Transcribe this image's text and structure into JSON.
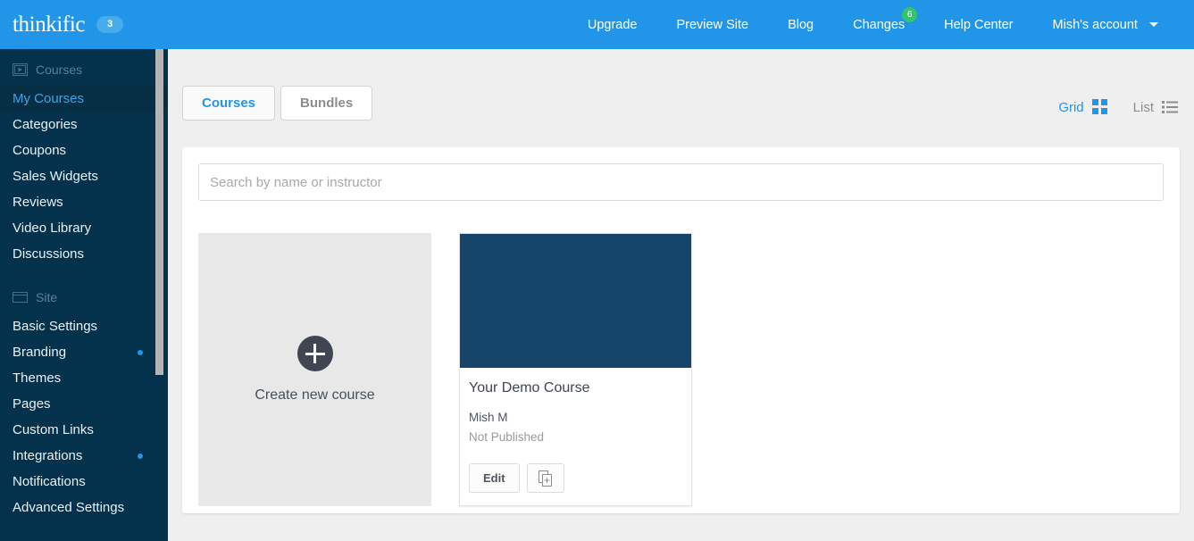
{
  "topbar": {
    "brand": "thinkific",
    "brand_badge": "3",
    "nav": [
      {
        "label": "Upgrade",
        "badge": null,
        "icon": null
      },
      {
        "label": "Preview Site",
        "badge": null,
        "icon": null
      },
      {
        "label": "Blog",
        "badge": null,
        "icon": null
      },
      {
        "label": "Changes",
        "badge": "6",
        "icon": null
      },
      {
        "label": "Help Center",
        "badge": null,
        "icon": null
      },
      {
        "label": "Mish's account",
        "badge": null,
        "icon": "chevron-down-icon"
      }
    ],
    "colors": {
      "background": "#2196e8",
      "badge": "#46aceb",
      "nav_badge": "#35c46a"
    }
  },
  "sidebar": {
    "colors": {
      "background": "#04314c",
      "active_background": "#062f45",
      "active_text": "#3ba3e8",
      "dot": "#2196e8"
    },
    "sections": [
      {
        "label": "Courses",
        "icon": "video-slide-icon",
        "items": [
          {
            "label": "My Courses",
            "active": true,
            "dot": false
          },
          {
            "label": "Categories",
            "active": false,
            "dot": false
          },
          {
            "label": "Coupons",
            "active": false,
            "dot": false
          },
          {
            "label": "Sales Widgets",
            "active": false,
            "dot": false
          },
          {
            "label": "Reviews",
            "active": false,
            "dot": false
          },
          {
            "label": "Video Library",
            "active": false,
            "dot": false
          },
          {
            "label": "Discussions",
            "active": false,
            "dot": false
          }
        ]
      },
      {
        "label": "Site",
        "icon": "browser-window-icon",
        "items": [
          {
            "label": "Basic Settings",
            "active": false,
            "dot": false
          },
          {
            "label": "Branding",
            "active": false,
            "dot": true
          },
          {
            "label": "Themes",
            "active": false,
            "dot": false
          },
          {
            "label": "Pages",
            "active": false,
            "dot": false
          },
          {
            "label": "Custom Links",
            "active": false,
            "dot": false
          },
          {
            "label": "Integrations",
            "active": false,
            "dot": true
          },
          {
            "label": "Notifications",
            "active": false,
            "dot": false
          },
          {
            "label": "Advanced Settings",
            "active": false,
            "dot": false
          }
        ]
      }
    ]
  },
  "main": {
    "tabs": [
      {
        "label": "Courses",
        "active": true
      },
      {
        "label": "Bundles",
        "active": false
      }
    ],
    "view_toggle": [
      {
        "label": "Grid",
        "icon": "grid-view-icon",
        "active": true
      },
      {
        "label": "List",
        "icon": "list-view-icon",
        "active": false
      }
    ],
    "search": {
      "placeholder": "Search by name or instructor",
      "value": ""
    },
    "new_course": {
      "label": "Create new course",
      "icon": "plus-circle-icon"
    },
    "courses": [
      {
        "title": "Your Demo Course",
        "author": "Mish M",
        "status": "Not Published",
        "thumb_color": "#16456b",
        "edit_label": "Edit",
        "duplicate_icon": "duplicate-icon"
      }
    ]
  }
}
